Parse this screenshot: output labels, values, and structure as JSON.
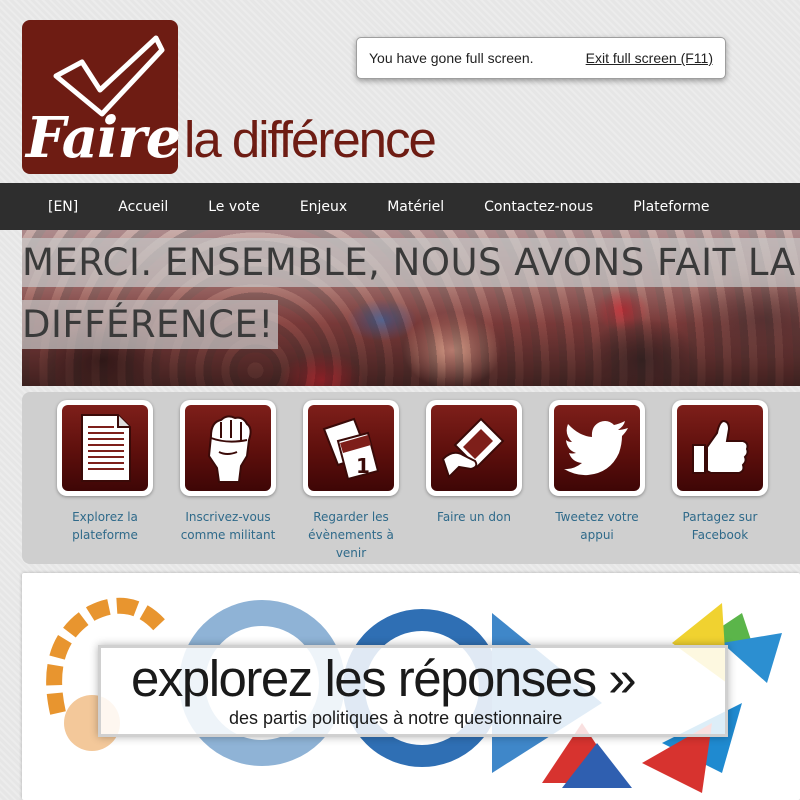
{
  "header": {
    "logo_word": "Faire",
    "logo_tagline": "la différence",
    "logo_icon": "checkmark-icon"
  },
  "fullscreen_notice": {
    "message": "You have gone full screen.",
    "exit_label": "Exit full screen (F11)"
  },
  "nav": {
    "items": [
      {
        "label": "[EN]"
      },
      {
        "label": "Accueil"
      },
      {
        "label": "Le vote"
      },
      {
        "label": "Enjeux"
      },
      {
        "label": "Matériel"
      },
      {
        "label": "Contactez-nous"
      },
      {
        "label": "Plateforme"
      }
    ]
  },
  "hero": {
    "line1": "MERCI. ENSEMBLE, NOUS AVONS FAIT LA",
    "line2": "DIFFÉRENCE!"
  },
  "actions": [
    {
      "icon": "document-icon",
      "label_lines": [
        "Explorez la",
        "plateforme"
      ]
    },
    {
      "icon": "raised-fist-icon",
      "label_lines": [
        "Inscrivez-vous",
        "comme militant"
      ]
    },
    {
      "icon": "calendar-icon",
      "label_lines": [
        "Regarder les",
        "évènements à",
        "venir"
      ]
    },
    {
      "icon": "donation-card-icon",
      "label_lines": [
        "Faire un don"
      ]
    },
    {
      "icon": "twitter-bird-icon",
      "label_lines": [
        "Tweetez votre",
        "appui"
      ]
    },
    {
      "icon": "thumbs-up-icon",
      "label_lines": [
        "Partagez sur",
        "Facebook"
      ]
    }
  ],
  "banner": {
    "title": "explorez les réponses »",
    "subtitle": "des partis politiques à notre questionnaire"
  },
  "colors": {
    "brand": "#6e1c13",
    "nav_bg": "#2e2e2e",
    "link": "#2f6a8a"
  }
}
